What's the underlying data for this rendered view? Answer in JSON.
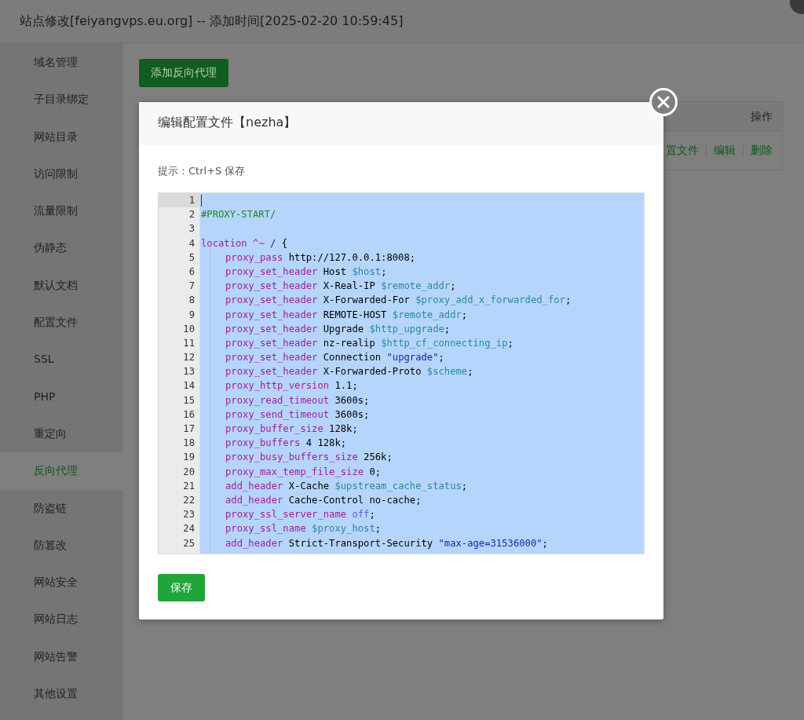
{
  "window": {
    "title": "站点修改[feiyangvps.eu.org] -- 添加时间[2025-02-20 10:59:45]"
  },
  "sidebar": {
    "items": [
      {
        "label": "域名管理",
        "selected": false
      },
      {
        "label": "子目录绑定",
        "selected": false
      },
      {
        "label": "网站目录",
        "selected": false
      },
      {
        "label": "访问限制",
        "selected": false
      },
      {
        "label": "流量限制",
        "selected": false
      },
      {
        "label": "伪静态",
        "selected": false
      },
      {
        "label": "默认文档",
        "selected": false
      },
      {
        "label": "配置文件",
        "selected": false
      },
      {
        "label": "SSL",
        "selected": false
      },
      {
        "label": "PHP",
        "selected": false
      },
      {
        "label": "重定向",
        "selected": false
      },
      {
        "label": "反向代理",
        "selected": true
      },
      {
        "label": "防盗链",
        "selected": false
      },
      {
        "label": "防篡改",
        "selected": false
      },
      {
        "label": "网站安全",
        "selected": false
      },
      {
        "label": "网站日志",
        "selected": false
      },
      {
        "label": "网站告警",
        "selected": false
      },
      {
        "label": "其他设置",
        "selected": false
      }
    ]
  },
  "add_button": "添加反向代理",
  "table": {
    "columns": [
      "操作"
    ],
    "row_actions": [
      "置文件",
      "编辑",
      "删除"
    ]
  },
  "modal": {
    "title": "编辑配置文件【nezha】",
    "hint": "提示：Ctrl+S 保存",
    "save_button": "保存",
    "editor": {
      "selected": true,
      "lines": [
        {
          "number": "1",
          "active": true,
          "indent": false
        },
        {
          "number": "2",
          "active": false,
          "indent": false,
          "tokens": [
            {
              "kind": "comment",
              "text": "#PROXY-START/"
            }
          ]
        },
        {
          "number": "3",
          "active": false,
          "indent": false
        },
        {
          "number": "4",
          "active": false,
          "indent": false,
          "tokens": [
            {
              "kind": "kw",
              "text": "location"
            },
            {
              "kind": "kw",
              "text": " ^~"
            },
            {
              "kind": "str",
              "text": " /"
            },
            {
              "kind": "plain",
              "text": " {"
            }
          ]
        },
        {
          "number": "5",
          "active": false,
          "indent": true,
          "tokens": [
            {
              "kind": "kw",
              "text": "proxy_pass"
            },
            {
              "kind": "plain",
              "text": " http://127.0.0.1:8008;"
            }
          ]
        },
        {
          "number": "6",
          "active": false,
          "indent": true,
          "tokens": [
            {
              "kind": "kw",
              "text": "proxy_set_header"
            },
            {
              "kind": "plain",
              "text": " Host "
            },
            {
              "kind": "var",
              "text": "$host"
            },
            {
              "kind": "plain",
              "text": ";"
            }
          ]
        },
        {
          "number": "7",
          "active": false,
          "indent": true,
          "tokens": [
            {
              "kind": "kw",
              "text": "proxy_set_header"
            },
            {
              "kind": "plain",
              "text": " X-Real-IP "
            },
            {
              "kind": "var",
              "text": "$remote_addr"
            },
            {
              "kind": "plain",
              "text": ";"
            }
          ]
        },
        {
          "number": "8",
          "active": false,
          "indent": true,
          "tokens": [
            {
              "kind": "kw",
              "text": "proxy_set_header"
            },
            {
              "kind": "plain",
              "text": " X-Forwarded-For "
            },
            {
              "kind": "var",
              "text": "$proxy_add_x_forwarded_for"
            },
            {
              "kind": "plain",
              "text": ";"
            }
          ]
        },
        {
          "number": "9",
          "active": false,
          "indent": true,
          "tokens": [
            {
              "kind": "kw",
              "text": "proxy_set_header"
            },
            {
              "kind": "plain",
              "text": " REMOTE-HOST "
            },
            {
              "kind": "var",
              "text": "$remote_addr"
            },
            {
              "kind": "plain",
              "text": ";"
            }
          ]
        },
        {
          "number": "10",
          "active": false,
          "indent": true,
          "tokens": [
            {
              "kind": "kw",
              "text": "proxy_set_header"
            },
            {
              "kind": "plain",
              "text": " Upgrade "
            },
            {
              "kind": "var",
              "text": "$http_upgrade"
            },
            {
              "kind": "plain",
              "text": ";"
            }
          ]
        },
        {
          "number": "11",
          "active": false,
          "indent": true,
          "tokens": [
            {
              "kind": "kw",
              "text": "proxy_set_header"
            },
            {
              "kind": "plain",
              "text": " nz-realip "
            },
            {
              "kind": "var",
              "text": "$http_cf_connecting_ip"
            },
            {
              "kind": "plain",
              "text": ";"
            }
          ]
        },
        {
          "number": "12",
          "active": false,
          "indent": true,
          "tokens": [
            {
              "kind": "kw",
              "text": "proxy_set_header"
            },
            {
              "kind": "plain",
              "text": " Connection "
            },
            {
              "kind": "str",
              "text": "\"upgrade\""
            },
            {
              "kind": "plain",
              "text": ";"
            }
          ]
        },
        {
          "number": "13",
          "active": false,
          "indent": true,
          "tokens": [
            {
              "kind": "kw",
              "text": "proxy_set_header"
            },
            {
              "kind": "plain",
              "text": " X-Forwarded-Proto "
            },
            {
              "kind": "var",
              "text": "$scheme"
            },
            {
              "kind": "plain",
              "text": ";"
            }
          ]
        },
        {
          "number": "14",
          "active": false,
          "indent": true,
          "tokens": [
            {
              "kind": "kw",
              "text": "proxy_http_version"
            },
            {
              "kind": "plain",
              "text": " 1.1;"
            }
          ]
        },
        {
          "number": "15",
          "active": false,
          "indent": true,
          "tokens": [
            {
              "kind": "kw",
              "text": "proxy_read_timeout"
            },
            {
              "kind": "plain",
              "text": " 3600s;"
            }
          ]
        },
        {
          "number": "16",
          "active": false,
          "indent": true,
          "tokens": [
            {
              "kind": "kw",
              "text": "proxy_send_timeout"
            },
            {
              "kind": "plain",
              "text": " 3600s;"
            }
          ]
        },
        {
          "number": "17",
          "active": false,
          "indent": true,
          "tokens": [
            {
              "kind": "kw",
              "text": "proxy_buffer_size"
            },
            {
              "kind": "plain",
              "text": " 128k;"
            }
          ]
        },
        {
          "number": "18",
          "active": false,
          "indent": true,
          "tokens": [
            {
              "kind": "kw",
              "text": "proxy_buffers"
            },
            {
              "kind": "plain",
              "text": " 4 128k;"
            }
          ]
        },
        {
          "number": "19",
          "active": false,
          "indent": true,
          "tokens": [
            {
              "kind": "kw",
              "text": "proxy_busy_buffers_size"
            },
            {
              "kind": "plain",
              "text": " 256k;"
            }
          ]
        },
        {
          "number": "20",
          "active": false,
          "indent": true,
          "tokens": [
            {
              "kind": "kw",
              "text": "proxy_max_temp_file_size"
            },
            {
              "kind": "plain",
              "text": " 0;"
            }
          ]
        },
        {
          "number": "21",
          "active": false,
          "indent": true,
          "tokens": [
            {
              "kind": "kw",
              "text": "add_header"
            },
            {
              "kind": "plain",
              "text": " X-Cache "
            },
            {
              "kind": "var",
              "text": "$upstream_cache_status"
            },
            {
              "kind": "plain",
              "text": ";"
            }
          ]
        },
        {
          "number": "22",
          "active": false,
          "indent": true,
          "tokens": [
            {
              "kind": "kw",
              "text": "add_header"
            },
            {
              "kind": "plain",
              "text": " Cache-Control no-cache;"
            }
          ]
        },
        {
          "number": "23",
          "active": false,
          "indent": true,
          "tokens": [
            {
              "kind": "kw",
              "text": "proxy_ssl_server_name"
            },
            {
              "kind": "atom",
              "text": " off"
            },
            {
              "kind": "plain",
              "text": ";"
            }
          ]
        },
        {
          "number": "24",
          "active": false,
          "indent": true,
          "tokens": [
            {
              "kind": "kw",
              "text": "proxy_ssl_name"
            },
            {
              "kind": "var",
              "text": " $proxy_host"
            },
            {
              "kind": "plain",
              "text": ";"
            }
          ]
        },
        {
          "number": "25",
          "active": false,
          "indent": true,
          "tokens": [
            {
              "kind": "kw",
              "text": "add_header"
            },
            {
              "kind": "plain",
              "text": " Strict-Transport-Security "
            },
            {
              "kind": "str",
              "text": "\"max-age=31536000\""
            },
            {
              "kind": "plain",
              "text": ";"
            }
          ]
        }
      ]
    }
  }
}
